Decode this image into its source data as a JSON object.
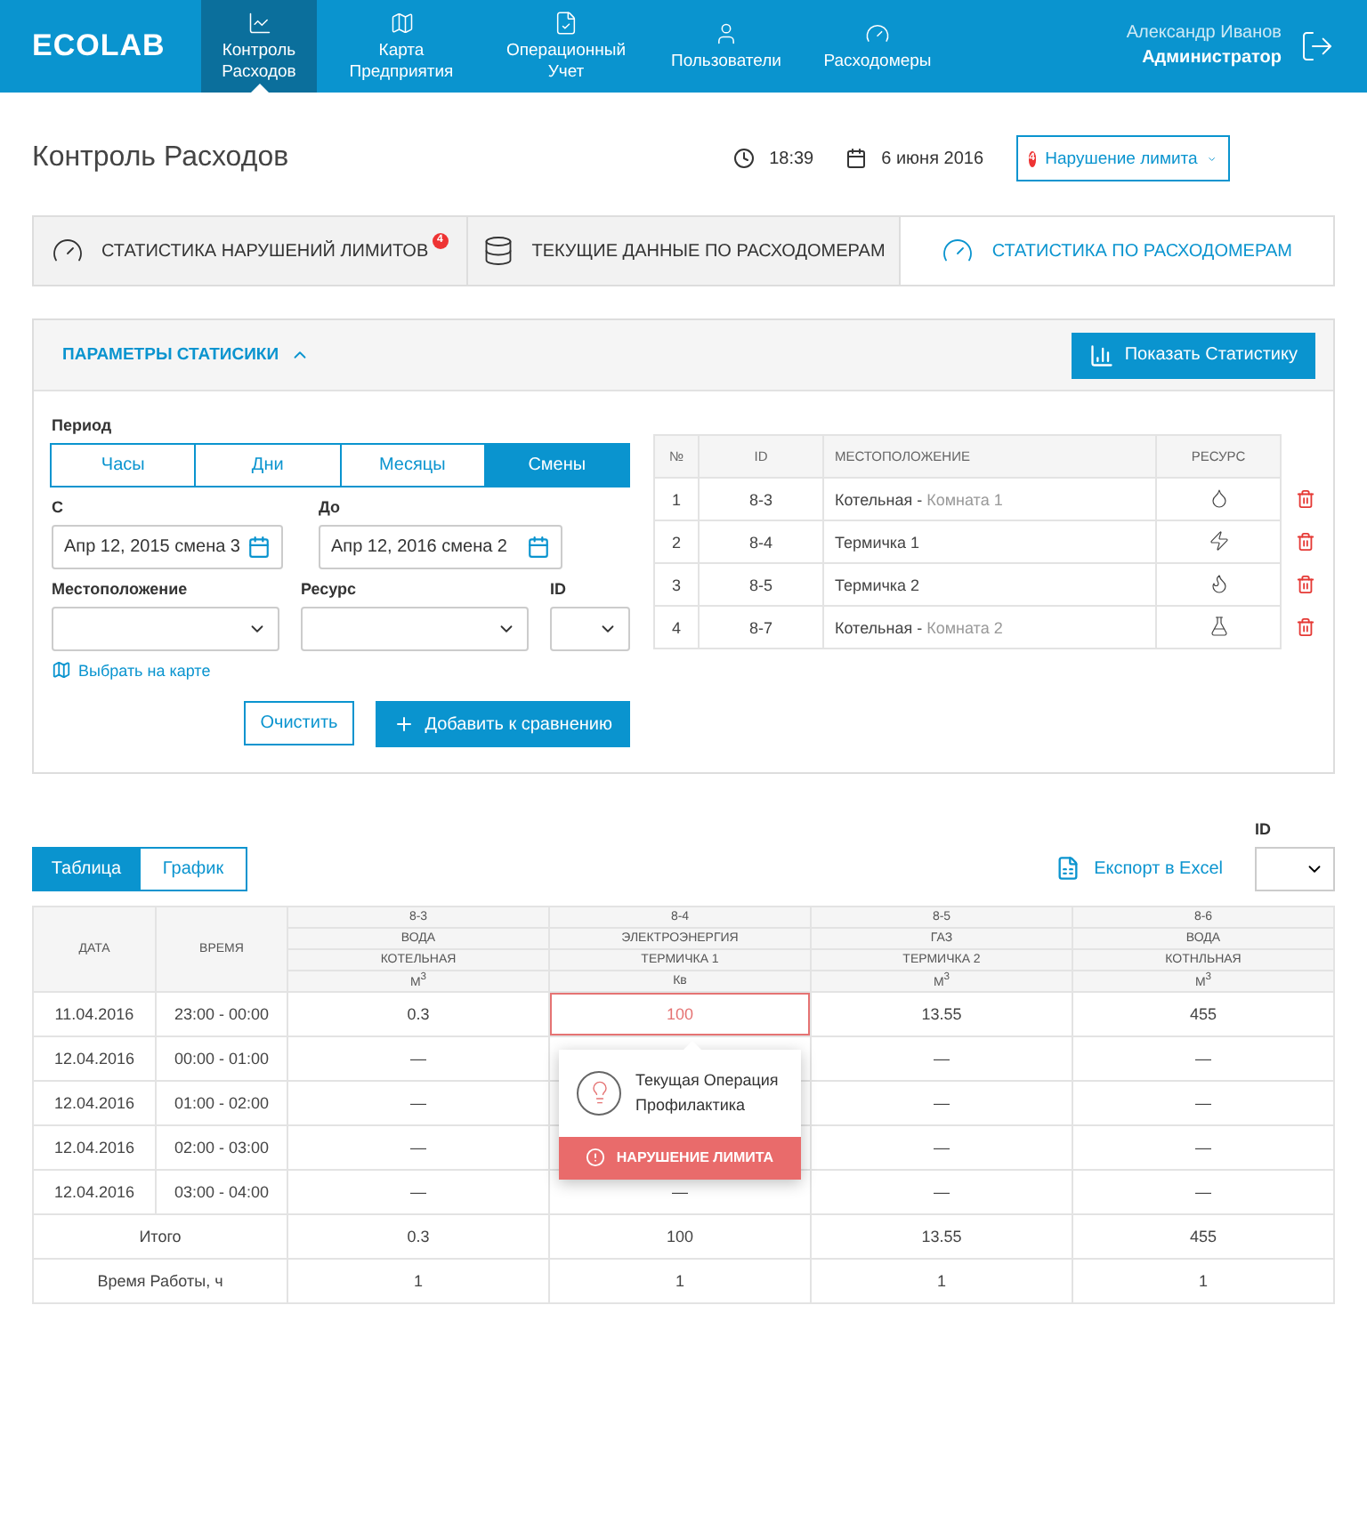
{
  "header": {
    "logo": "ECOLAB",
    "nav": [
      {
        "label": "Контроль Расходов",
        "kind": "chart",
        "selected": true
      },
      {
        "label": "Карта Предприятия",
        "kind": "map",
        "selected": false
      },
      {
        "label": "Операционный Учет",
        "kind": "doc",
        "selected": false
      },
      {
        "label": "Пользователи",
        "kind": "user",
        "selected": false
      },
      {
        "label": "Расходомеры",
        "kind": "meter",
        "selected": false
      }
    ],
    "user": {
      "name": "Александр Иванов",
      "role": "Администратор"
    }
  },
  "page": {
    "title": "Контроль Расходов",
    "time": "18:39",
    "date": "6 июня 2016",
    "alert_select": {
      "badge": "4",
      "value": "Нарушение лимита"
    }
  },
  "tabs": [
    {
      "label": "СТАТИСТИКА НАРУШЕНИЙ ЛИМИТОВ",
      "kind": "gauge",
      "badge": "4",
      "selected": false
    },
    {
      "label": "ТЕКУЩИЕ ДАННЫЕ ПО РАСХОДОМЕРАМ",
      "kind": "db",
      "selected": false
    },
    {
      "label": "СТАТИСТИКА ПО РАСХОДОМЕРАМ",
      "kind": "gauge",
      "selected": true
    }
  ],
  "params": {
    "title": "ПАРАМЕТРЫ СТАТИСИКИ",
    "expanded": true,
    "show_button": "Показать Статистику",
    "period_label": "Период",
    "periods": [
      {
        "label": "Часы",
        "selected": false
      },
      {
        "label": "Дни",
        "selected": false
      },
      {
        "label": "Месяцы",
        "selected": false
      },
      {
        "label": "Смены",
        "selected": true
      }
    ],
    "from": {
      "label": "С",
      "value": "Апр 12, 2015  смена 3"
    },
    "to": {
      "label": "До",
      "value": "Апр 12, 2016   смена 2"
    },
    "location_label": "Местоположение",
    "resource_label": "Ресурс",
    "id_label": "ID",
    "map_link": "Выбрать на карте",
    "clear_button": "Очистить",
    "add_button": "Добавить к сравнению",
    "meters": {
      "columns": [
        "№",
        "ID",
        "МЕСТОПОЛОЖЕНИЕ",
        "РЕСУРС"
      ],
      "rows": [
        {
          "num": "1",
          "id": "8-3",
          "place": "Котельная -",
          "room": "Комната 1",
          "kind": "water"
        },
        {
          "num": "2",
          "id": "8-4",
          "place": "Термичка 1",
          "kind": "power"
        },
        {
          "num": "3",
          "id": "8-5",
          "place": "Термичка 2",
          "kind": "gas"
        },
        {
          "num": "4",
          "id": "8-7",
          "place": "Котельная -",
          "room": "Комната 2",
          "kind": "nitrogen"
        }
      ]
    }
  },
  "results": {
    "views": [
      {
        "label": "Таблица",
        "selected": true
      },
      {
        "label": "График",
        "selected": false
      }
    ],
    "export": "Експорт в Excel",
    "id_label": "ID",
    "table": {
      "date_header": "ДАТА",
      "time_header": "ВРЕМЯ",
      "meters": [
        {
          "id": "8-3",
          "resource": "ВОДА",
          "place": "КОТЕЛЬНАЯ",
          "unit": "М$^{3}$"
        },
        {
          "id": "8-4",
          "resource": "ЭЛЕКТРОЭНЕРГИЯ",
          "place": "ТЕРМИЧКА 1",
          "unit": "Кв"
        },
        {
          "id": "8-5",
          "resource": "ГАЗ",
          "place": "ТЕРМИЧКА 2",
          "unit": "М$^{3}$"
        },
        {
          "id": "8-6",
          "resource": "ВОДА",
          "place": "КОТНЛЬНАЯ",
          "unit": "М$^{3}$"
        }
      ],
      "rows": [
        {
          "date": "11.04.2016",
          "time": "23:00 - 00:00",
          "cells": [
            {
              "value": "0.3",
              "alert": false
            },
            {
              "value": "100",
              "alert": true
            },
            {
              "value": "13.55",
              "alert": false
            },
            {
              "value": "455",
              "alert": false
            }
          ]
        },
        {
          "date": "12.04.2016",
          "time": "00:00 - 01:00",
          "cells": [
            {
              "value": "—",
              "alert": false
            },
            {
              "alert": false
            },
            {
              "value": "—",
              "alert": false
            },
            {
              "value": "—",
              "alert": false
            }
          ]
        },
        {
          "date": "12.04.2016",
          "time": "01:00 - 02:00",
          "cells": [
            {
              "value": "—",
              "alert": false
            },
            {
              "alert": false
            },
            {
              "value": "—",
              "alert": false
            },
            {
              "value": "—",
              "alert": false
            }
          ]
        },
        {
          "date": "12.04.2016",
          "time": "02:00 - 03:00",
          "cells": [
            {
              "value": "—",
              "alert": false
            },
            {
              "alert": false
            },
            {
              "value": "—",
              "alert": false
            },
            {
              "value": "—",
              "alert": false
            }
          ]
        },
        {
          "date": "12.04.2016",
          "time": "03:00 - 04:00",
          "cells": [
            {
              "value": "—",
              "alert": false
            },
            {
              "value": "—",
              "alert": false
            },
            {
              "value": "—",
              "alert": false
            },
            {
              "value": "—",
              "alert": false
            }
          ]
        }
      ],
      "totals": [
        {
          "label": "Итого",
          "values": [
            "0.3",
            "100",
            "13.55",
            "455"
          ]
        },
        {
          "label": "Время Работы, ч",
          "values": [
            "1",
            "1",
            "1",
            "1"
          ]
        }
      ],
      "popover": {
        "operation": "Текущая Операция",
        "name": "Профилактика",
        "alert": "НАРУШЕНИЕ ЛИМИТА"
      }
    }
  }
}
